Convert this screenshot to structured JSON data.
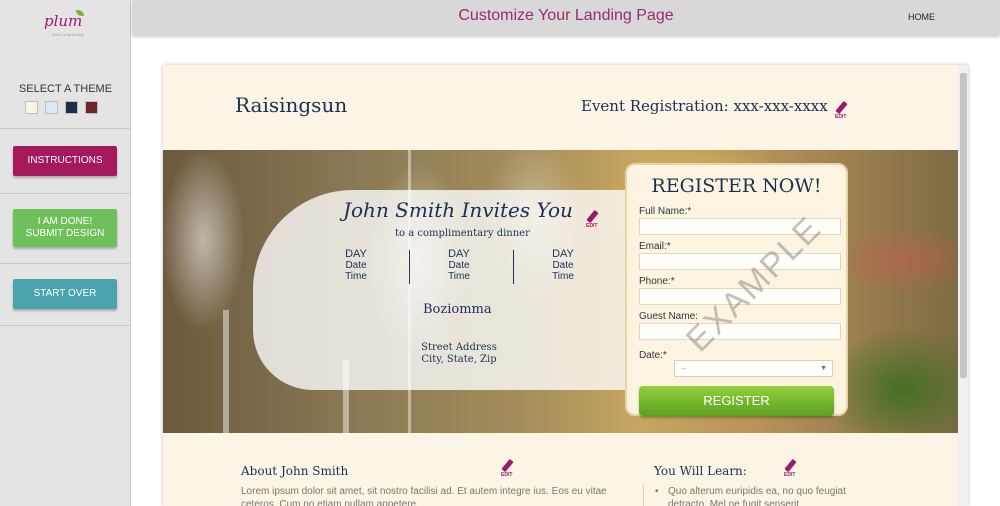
{
  "app": {
    "logo_text": "plum",
    "logo_sub": "direct marketing",
    "title": "Customize Your Landing Page",
    "home_link": "HOME"
  },
  "sidebar": {
    "theme_label": "SELECT A THEME",
    "swatches": [
      "#fcf4e3",
      "#dde9f2",
      "#1c2f45",
      "#6e2523"
    ],
    "instructions_label": "INSTRUCTIONS",
    "done_label_1": "I AM DONE!",
    "done_label_2": "SUBMIT DESIGN",
    "start_over_label": "START OVER"
  },
  "preview": {
    "site_name": "Raisingsun",
    "event_registration": "Event Registration: xxx-xxx-xxxx",
    "edit_label": "EDIT",
    "invite": {
      "title": "John Smith Invites You",
      "subtitle": "to a complimentary dinner",
      "events": [
        {
          "day": "DAY",
          "date": "Date",
          "time": "Time"
        },
        {
          "day": "DAY",
          "date": "Date",
          "time": "Time"
        },
        {
          "day": "DAY",
          "date": "Date",
          "time": "Time"
        }
      ],
      "venue": "Boziomma",
      "street": "Street Address",
      "city_state_zip": "City, State, Zip"
    },
    "register": {
      "title": "REGISTER NOW!",
      "full_name_label": "Full Name:*",
      "email_label": "Email:*",
      "phone_label": "Phone:*",
      "guest_name_label": "Guest Name:",
      "date_label": "Date:*",
      "date_value": "--",
      "button_label": "REGISTER",
      "watermark": "EXAMPLE"
    },
    "about": {
      "title": "About John Smith",
      "text": "Lorem ipsum dolor sit amet, sit nostro facilisi ad. Et autem integre ius. Eos eu vitae ceteros. Cum no etiam nullam appetere."
    },
    "learn": {
      "title": "You Will Learn:",
      "text": "Quo alterum euripidis ea, no quo feugiat detracto. Mel ne fugit senserit"
    }
  },
  "colors": {
    "accent": "#9b1a6a",
    "navy": "#1c2f55",
    "green": "#6ec15a",
    "teal": "#4ba3ad"
  }
}
